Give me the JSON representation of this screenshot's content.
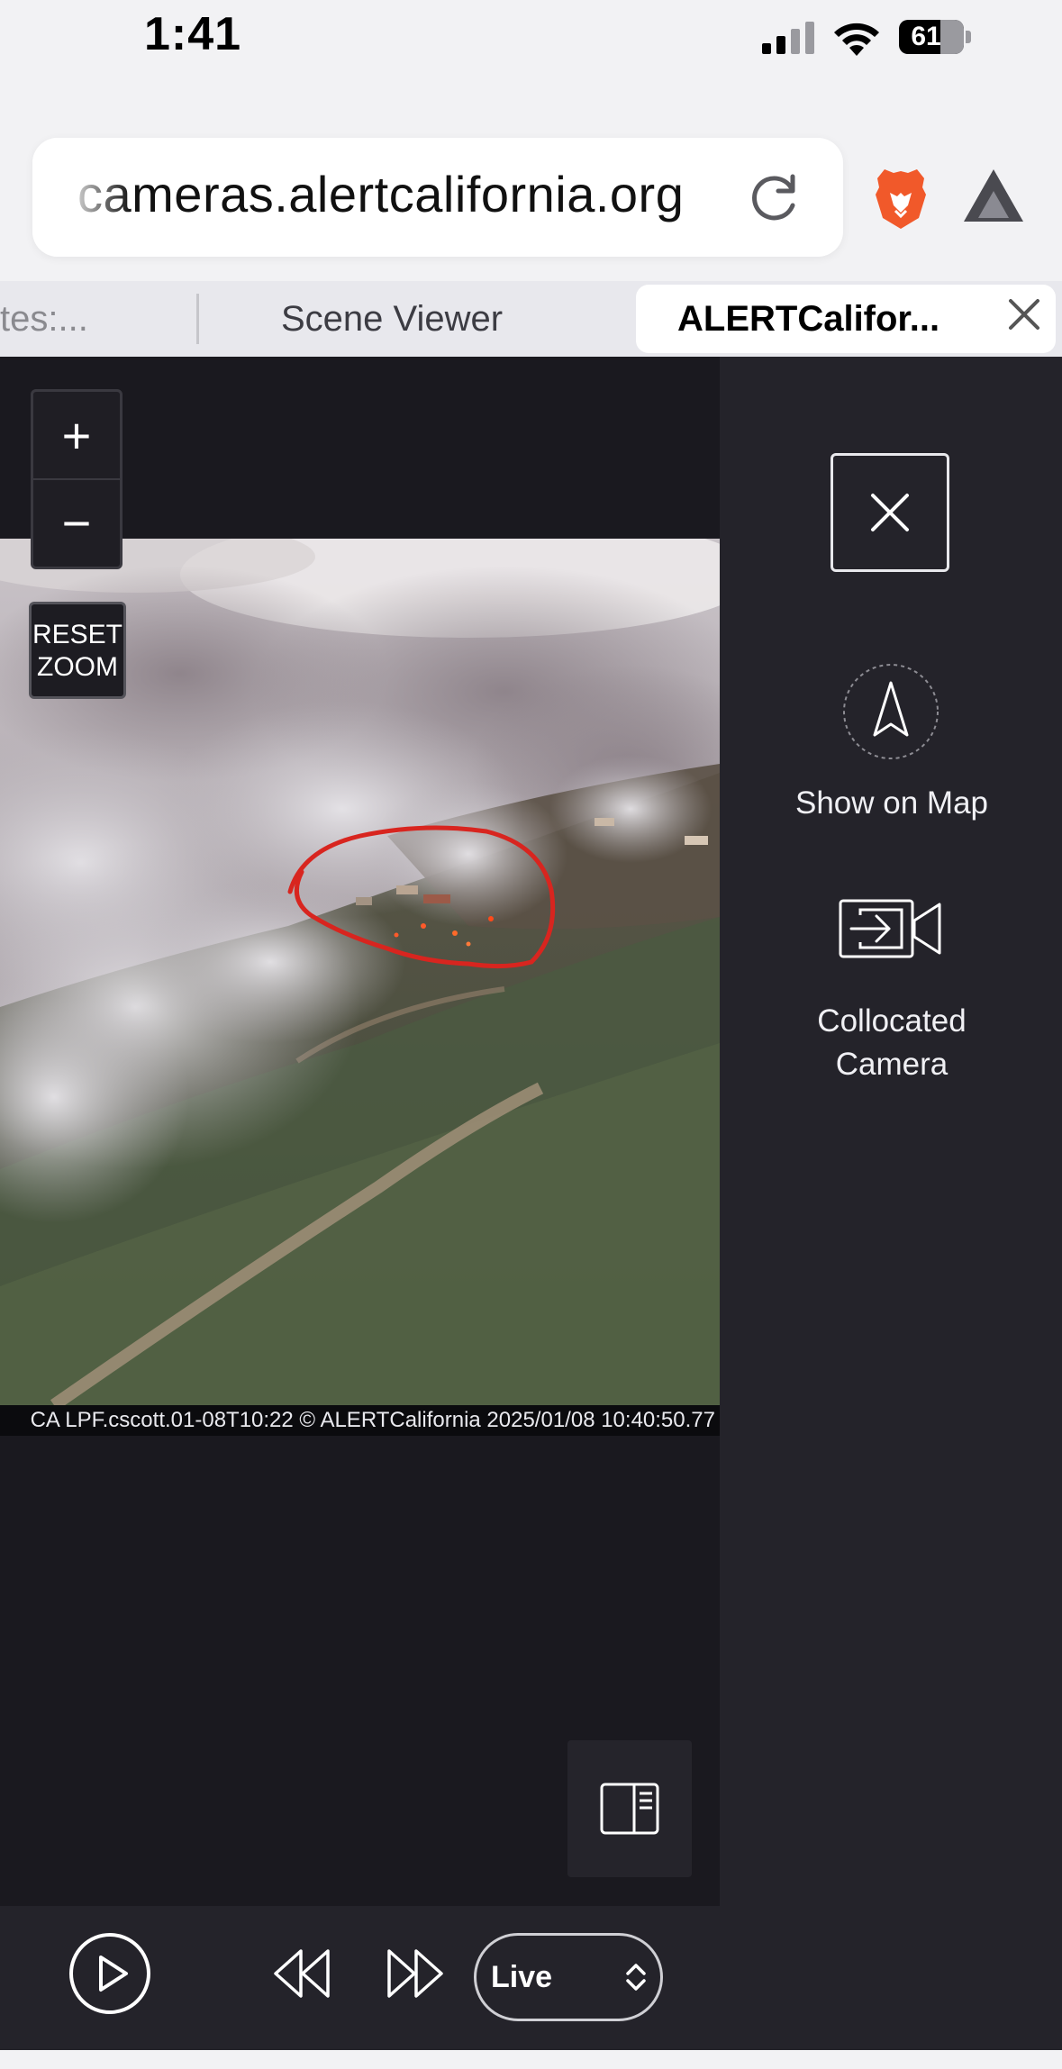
{
  "status_bar": {
    "time": "1:41",
    "battery": "61"
  },
  "browser": {
    "url": "cameras.alertcalifornia.org",
    "tabs": [
      {
        "label": "tes:..."
      },
      {
        "label": "Scene Viewer"
      },
      {
        "label": "ALERTCalifor..."
      }
    ]
  },
  "viewer": {
    "zoom_in": "+",
    "zoom_out": "−",
    "reset_zoom": [
      "RESET",
      "ZOOM"
    ],
    "caption": "CA LPF.cscott.01-08T10:22 © ALERTCalifornia 2025/01/08 10:40:50.77"
  },
  "side_panel": {
    "show_on_map": "Show on Map",
    "collocated_camera": [
      "Collocated",
      "Camera"
    ]
  },
  "player": {
    "live_label": "Live"
  },
  "icons": {
    "reload": "reload-icon",
    "brave": "brave-lion-icon",
    "triangle": "brave-rewards-triangle-icon",
    "close": "close-icon",
    "map": "navigation-arrow-icon",
    "camera": "camera-enter-icon",
    "panel": "panel-toggle-icon",
    "play": "play-icon",
    "rewind": "rewind-icon",
    "forward": "fast-forward-icon"
  },
  "colors": {
    "content_bg": "#1a191f",
    "panel_bg": "#24232a",
    "annotation_red": "#d8251f",
    "brave_orange": "#f1592a"
  }
}
